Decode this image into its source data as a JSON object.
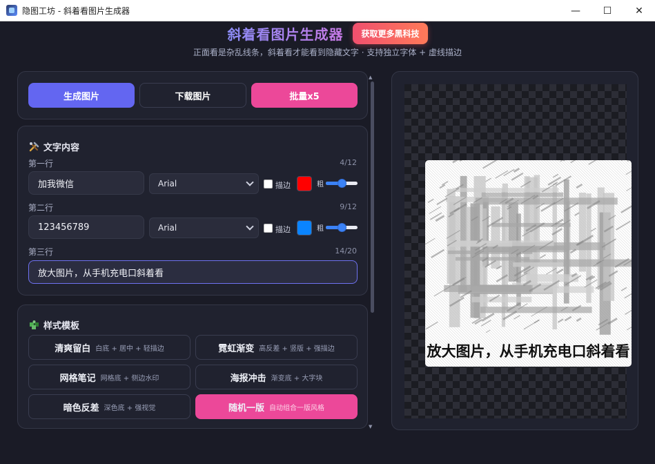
{
  "window": {
    "title": "隐图工坊 - 斜着看图片生成器",
    "minimize": "—",
    "maximize": "☐",
    "close": "✕"
  },
  "header": {
    "title": "斜着看图片生成器",
    "promo": "获取更多黑科技",
    "subtitle": "正面看是杂乱线条，斜着看才能看到隐藏文字 · 支持独立字体 + 虚线描边"
  },
  "actions": {
    "generate": "生成图片",
    "download": "下载图片",
    "batch": "批量x5"
  },
  "text_section": {
    "title": "文字内容",
    "icon": "tools-icon",
    "rows": [
      {
        "label": "第一行",
        "count": "4/12",
        "value": "加我微信",
        "font": "Arial",
        "stroke_label": "描边",
        "stroke_checked": false,
        "color": "#ff0000",
        "bold_label": "粗",
        "bold_level": 0.5
      },
      {
        "label": "第二行",
        "count": "9/12",
        "value": "123456789",
        "font": "Arial",
        "stroke_label": "描边",
        "stroke_checked": false,
        "color": "#0a84ff",
        "bold_label": "粗",
        "bold_level": 0.5
      },
      {
        "label": "第三行",
        "count": "14/20",
        "value": "放大图片，从手机充电口斜着看"
      }
    ]
  },
  "style_section": {
    "title": "样式模板",
    "icon": "puzzle-icon",
    "templates": [
      {
        "name": "清爽留白",
        "desc": "白底 + 居中 + 轻描边",
        "active": false
      },
      {
        "name": "霓虹渐变",
        "desc": "高反差 + 竖版 + 强描边",
        "active": false
      },
      {
        "name": "网格笔记",
        "desc": "网格底 + 侧边水印",
        "active": false
      },
      {
        "name": "海报冲击",
        "desc": "渐变底 + 大字块",
        "active": false
      },
      {
        "name": "暗色反差",
        "desc": "深色底 + 强视觉",
        "active": false
      },
      {
        "name": "随机一版",
        "desc": "自动组合一版风格",
        "active": true
      }
    ]
  },
  "preview": {
    "caption": "放大图片，从手机充电口斜着看"
  },
  "colors": {
    "accent": "#6366f1",
    "pink": "#ec4899",
    "background": "#1a1b26"
  }
}
